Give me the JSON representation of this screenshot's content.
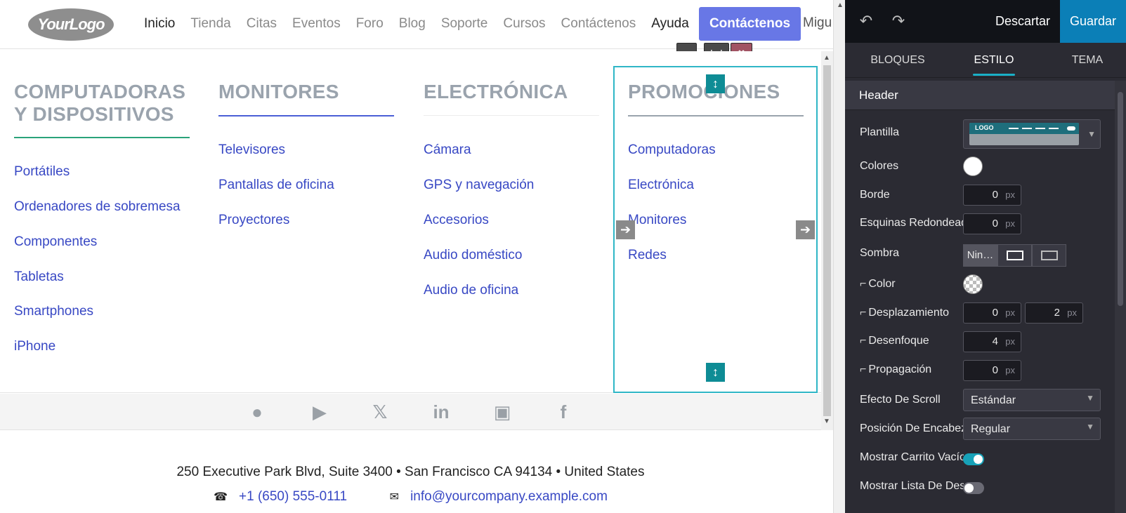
{
  "site": {
    "logo_text": "YourLogo",
    "nav": {
      "items": [
        "Inicio",
        "Tienda",
        "Citas",
        "Eventos",
        "Foro",
        "Blog",
        "Soporte",
        "Cursos",
        "Contáctenos",
        "Ayuda"
      ],
      "cta": "Contáctenos",
      "user": "Migu"
    },
    "toolbar": {
      "back_icon": "‹",
      "grid_icon": "⋮⋮",
      "delete_icon": "🗑"
    },
    "mega_menu": {
      "columns": [
        {
          "title": "COMPUTADORAS Y DISPOSITIVOS",
          "title_line1": "COMPUTADORAS",
          "title_line2": "Y DISPOSITIVOS",
          "links": [
            "Portátiles",
            "Ordenadores de sobremesa",
            "Componentes",
            "Tabletas",
            "Smartphones",
            "iPhone"
          ]
        },
        {
          "title": "MONITORES",
          "links": [
            "Televisores",
            "Pantallas de oficina",
            "Proyectores"
          ]
        },
        {
          "title": "ELECTRÓNICA",
          "links": [
            "Cámara",
            "GPS y navegación",
            "Accesorios",
            "Audio doméstico",
            "Audio de oficina"
          ]
        },
        {
          "title": "PROMOCIONES",
          "links": [
            "Computadoras",
            "Electrónica",
            "Monitores",
            "Redes"
          ]
        }
      ]
    },
    "social_icons": [
      "github-icon",
      "youtube-icon",
      "twitter-icon",
      "linkedin-icon",
      "instagram-icon",
      "facebook-icon"
    ],
    "footer": {
      "address": "250 Executive Park Blvd, Suite 3400 • San Francisco CA 94134 • United States",
      "phone": "+1 (650) 555-0111",
      "email": "info@yourcompany.example.com"
    }
  },
  "editor": {
    "discard": "Descartar",
    "save": "Guardar",
    "tabs": [
      "BLOQUES",
      "ESTILO",
      "TEMA"
    ],
    "active_tab": "ESTILO",
    "section": "Header",
    "template_logo": "LOGO",
    "options": {
      "plantilla": "Plantilla",
      "colores": "Colores",
      "borde": "Borde",
      "borde_val": "0",
      "esquinas": "Esquinas Redondeadas",
      "esquinas_val": "0",
      "sombra": "Sombra",
      "sombra_none": "Nin…",
      "color": "Color",
      "desplazamiento": "Desplazamiento",
      "desplazamiento_x": "0",
      "desplazamiento_y": "2",
      "desenfoque": "Desenfoque",
      "desenfoque_val": "4",
      "propagacion": "Propagación",
      "propagacion_val": "0",
      "efecto_scroll": "Efecto De Scroll",
      "efecto_scroll_val": "Estándar",
      "posicion": "Posición De Encabezado",
      "posicion_val": "Regular",
      "mostrar_carrito": "Mostrar Carrito Vacío",
      "mostrar_lista": "Mostrar Lista De Deseos",
      "unit": "px",
      "sub_prefix": "⌐"
    },
    "toggles": {
      "mostrar_carrito": true,
      "mostrar_lista": false
    }
  },
  "colors": {
    "accent": "#6877e6",
    "link": "#3848c4",
    "save": "#0b7fb7",
    "selection": "#2fb6c6"
  }
}
